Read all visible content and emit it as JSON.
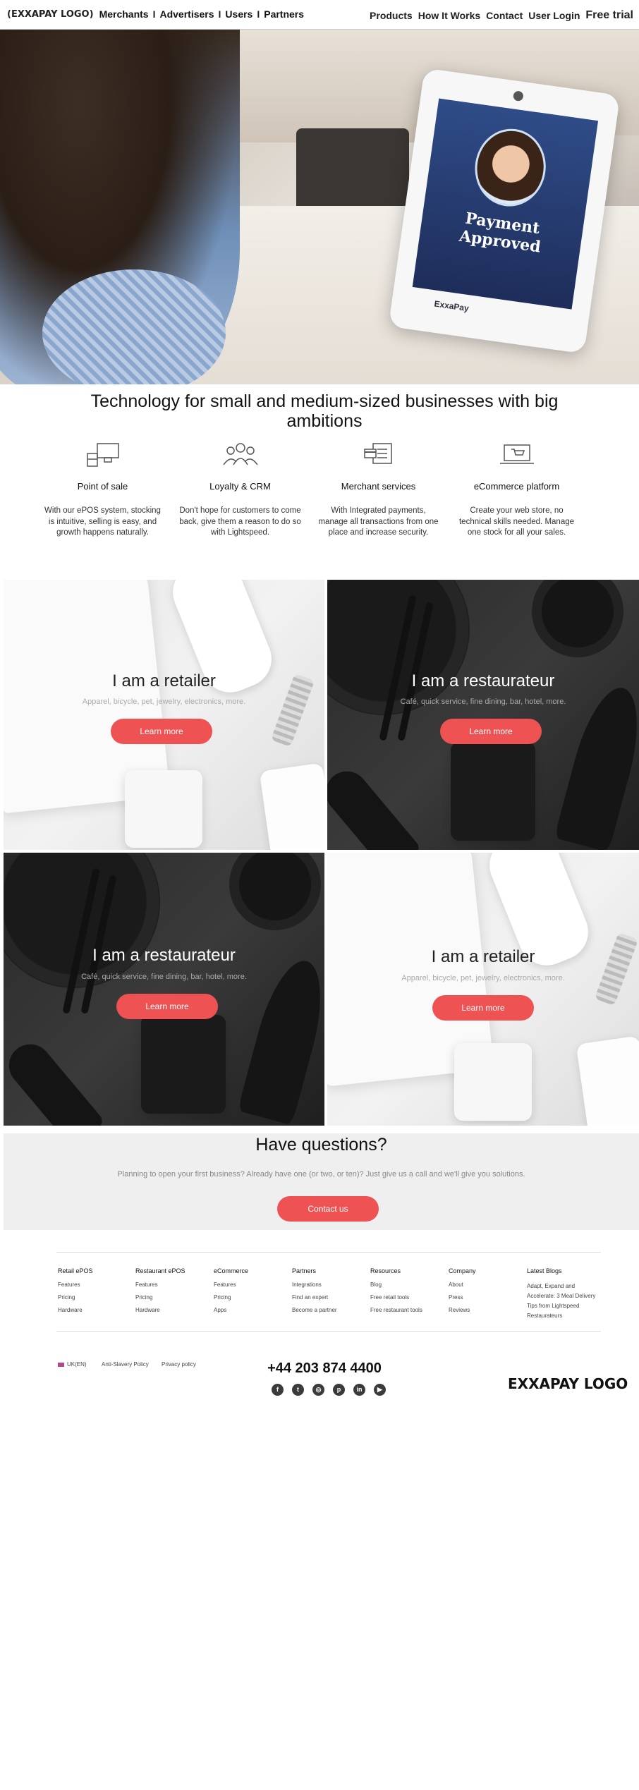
{
  "nav": {
    "logo": "(EXXAPAY LOGO)",
    "left_links": [
      "Merchants",
      "Advertisers",
      "Users",
      "Partners"
    ],
    "separators": [
      "I",
      "I",
      "I"
    ],
    "right_links": [
      "Products",
      "How It Works",
      "Contact",
      "User Login"
    ],
    "cta": "Free trial"
  },
  "hero": {
    "screen_text": "Payment Approved",
    "brand": "ExxaPay"
  },
  "tech": {
    "heading": "Technology for small and medium-sized businesses with big ambitions",
    "features": [
      {
        "icon": "pos-terminal-icon",
        "title": "Point of sale",
        "desc": "With our ePOS system, stocking is intuitive, selling is easy, and growth happens naturally."
      },
      {
        "icon": "people-group-icon",
        "title": "Loyalty & CRM",
        "desc": "Don't hope for customers to come back, give them a reason to do so with Lightspeed."
      },
      {
        "icon": "card-reader-icon",
        "title": "Merchant services",
        "desc": "With Integrated payments, manage all transactions from one place and increase security."
      },
      {
        "icon": "laptop-cart-icon",
        "title": "eCommerce platform",
        "desc": "Create your web store, no technical skills needed. Manage one stock for all your sales."
      }
    ]
  },
  "tiles": [
    {
      "title": "I am a retailer",
      "sub": "Apparel, bicycle, pet, jewelry, electronics, more.",
      "button": "Learn more"
    },
    {
      "title": "I am a restaurateur",
      "sub": "Café, quick service, fine dining, bar, hotel, more.",
      "button": "Learn more"
    },
    {
      "title": "I am a restaurateur",
      "sub": "Café, quick service, fine dining, bar, hotel, more.",
      "button": "Learn more"
    },
    {
      "title": "I am a retailer",
      "sub": "Apparel, bicycle, pet, jewelry, electronics, more.",
      "button": "Learn more"
    }
  ],
  "questions": {
    "heading": "Have questions?",
    "text": "Planning to open your first business? Already have one (or two, or ten)? Just give us a call and we'll give you solutions.",
    "button": "Contact us"
  },
  "footer": {
    "columns": [
      {
        "head": "Retail ePOS",
        "items": [
          "Features",
          "Pricing",
          "Hardware"
        ]
      },
      {
        "head": "Restaurant ePOS",
        "items": [
          "Features",
          "Pricing",
          "Hardware"
        ]
      },
      {
        "head": "eCommerce",
        "items": [
          "Features",
          "Pricing",
          "Apps"
        ]
      },
      {
        "head": "Partners",
        "items": [
          "Integrations",
          "Find an expert",
          "Become a partner"
        ]
      },
      {
        "head": "Resources",
        "items": [
          "Blog",
          "Free retail tools",
          "Free restaurant tools"
        ]
      },
      {
        "head": "Company",
        "items": [
          "About",
          "Press",
          "Reviews"
        ]
      },
      {
        "head": "Latest Blogs",
        "items": [
          "Adapt, Expand and Accelerate: 3 Meal Delivery Tips from Lightspeed Restaurateurs"
        ]
      }
    ],
    "locale": "UK(EN)",
    "legal": [
      "Anti-Slavery Policy",
      "Privacy policy"
    ],
    "phone": "+44 203 874 4400",
    "socials": [
      "f",
      "t",
      "◎",
      "p",
      "in",
      "▶"
    ],
    "logo": "EXXAPAY LOGO"
  }
}
